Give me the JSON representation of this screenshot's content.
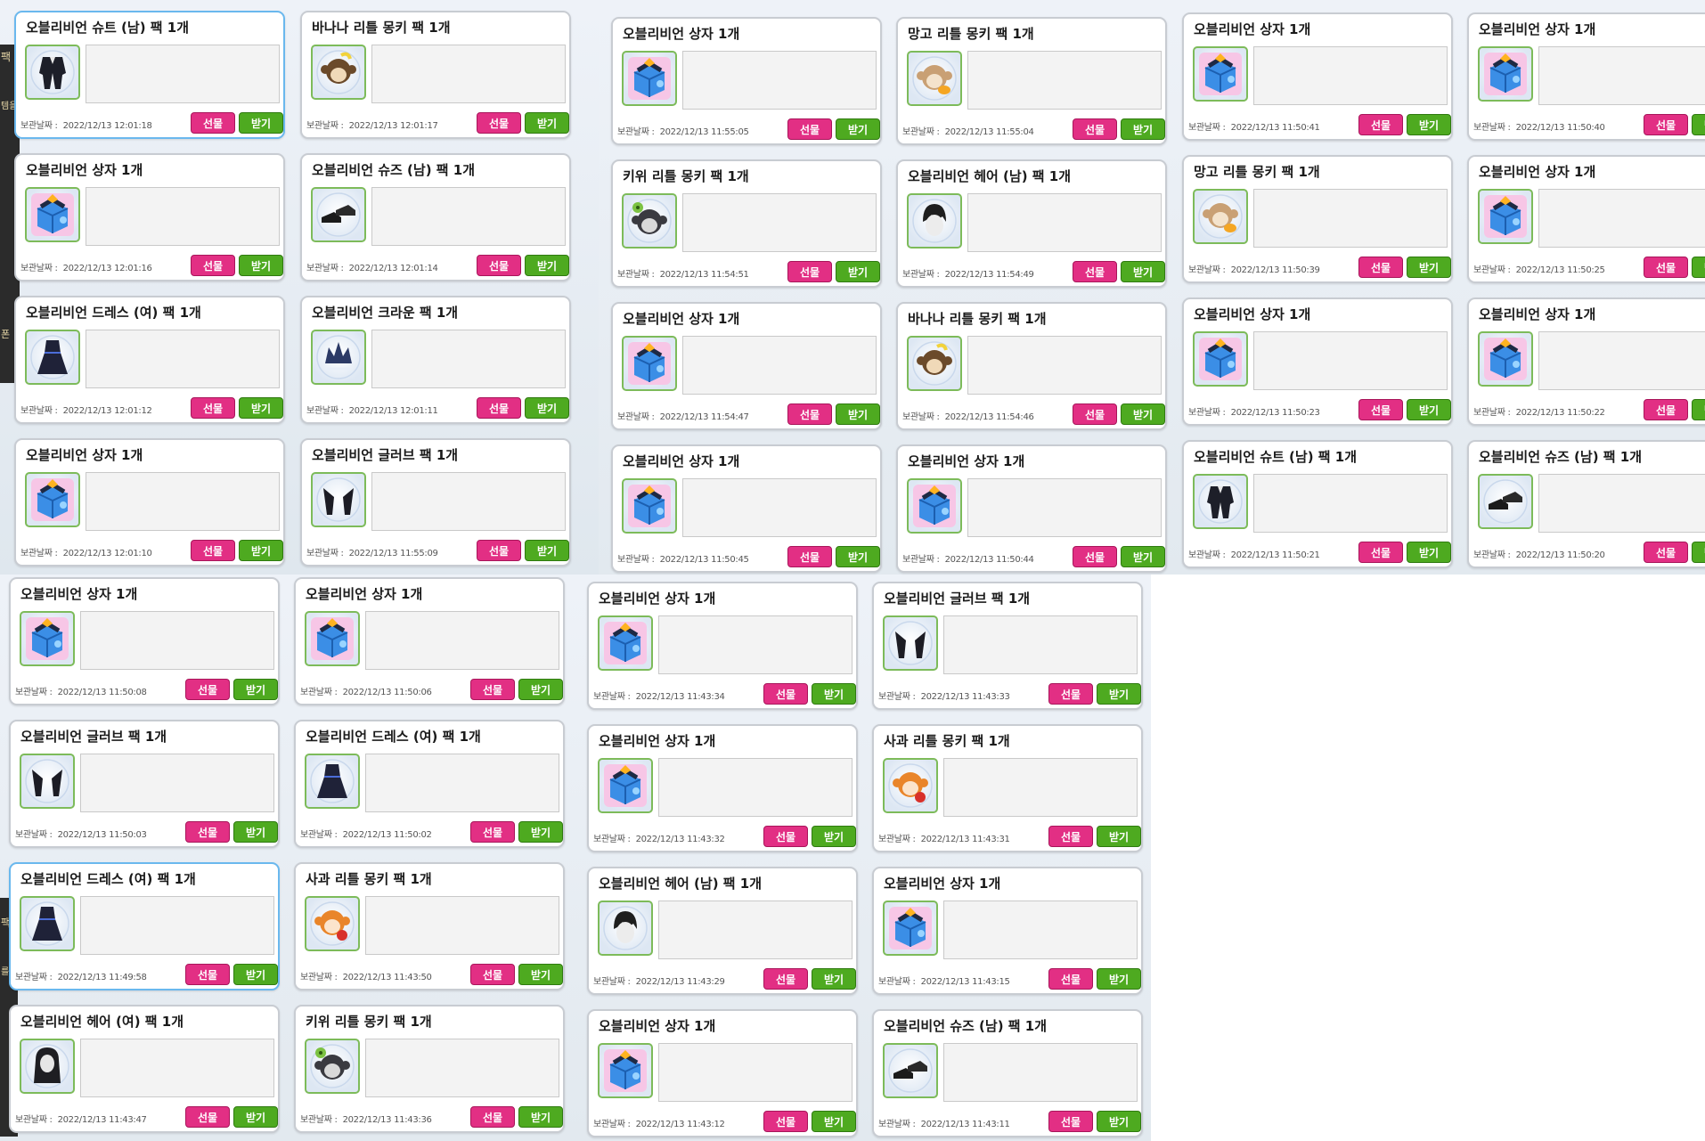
{
  "labels": {
    "date_label": "보관날짜 :",
    "gift_button": "선물",
    "receive_button": "받기"
  },
  "sidebar": {
    "left_top": [
      "팩",
      "템을",
      "폰"
    ],
    "left_bottom": [
      "팩",
      "를"
    ]
  },
  "colors": {
    "gift": "#e22f84",
    "receive": "#4eaa20",
    "selected_border": "#6ab8ee"
  },
  "cards": [
    {
      "title": "오블리비언 슈트 (남) 팩 1개",
      "icon": "suit-icon",
      "date": "2022/12/13 12:01:18",
      "selected": true
    },
    {
      "title": "바나나 리틀 몽키 팩 1개",
      "icon": "banana-monkey-icon",
      "date": "2022/12/13 12:01:17",
      "selected": false
    },
    {
      "title": "오블리비언 상자 1개",
      "icon": "gift-box-icon",
      "date": "2022/12/13 11:55:05",
      "selected": false
    },
    {
      "title": "망고 리틀 몽키 팩 1개",
      "icon": "mango-monkey-icon",
      "date": "2022/12/13 11:55:04",
      "selected": false
    },
    {
      "title": "오블리비언 상자 1개",
      "icon": "gift-box-icon",
      "date": "2022/12/13 11:50:41",
      "selected": false
    },
    {
      "title": "오블리비언 상자 1개",
      "icon": "gift-box-icon",
      "date": "2022/12/13 11:50:40",
      "selected": false
    },
    {
      "title": "오블리비언 상자 1개",
      "icon": "gift-box-icon",
      "date": "2022/12/13 12:01:16",
      "selected": false
    },
    {
      "title": "오블리비언 슈즈 (남) 팩 1개",
      "icon": "shoes-icon",
      "date": "2022/12/13 12:01:14",
      "selected": false
    },
    {
      "title": "키위 리틀 몽키 팩 1개",
      "icon": "kiwi-monkey-icon",
      "date": "2022/12/13 11:54:51",
      "selected": false
    },
    {
      "title": "오블리비언 헤어 (남) 팩 1개",
      "icon": "hair-male-icon",
      "date": "2022/12/13 11:54:49",
      "selected": false
    },
    {
      "title": "망고 리틀 몽키 팩 1개",
      "icon": "mango-monkey-icon",
      "date": "2022/12/13 11:50:39",
      "selected": false
    },
    {
      "title": "오블리비언 상자 1개",
      "icon": "gift-box-icon",
      "date": "2022/12/13 11:50:25",
      "selected": false
    },
    {
      "title": "오블리비언 드레스 (여) 팩 1개",
      "icon": "dress-icon",
      "date": "2022/12/13 12:01:12",
      "selected": false
    },
    {
      "title": "오블리비언 크라운 팩 1개",
      "icon": "crown-icon",
      "date": "2022/12/13 12:01:11",
      "selected": false
    },
    {
      "title": "오블리비언 상자 1개",
      "icon": "gift-box-icon",
      "date": "2022/12/13 11:54:47",
      "selected": false
    },
    {
      "title": "바나나 리틀 몽키 팩 1개",
      "icon": "banana-monkey-icon",
      "date": "2022/12/13 11:54:46",
      "selected": false
    },
    {
      "title": "오블리비언 상자 1개",
      "icon": "gift-box-icon",
      "date": "2022/12/13 11:50:23",
      "selected": false
    },
    {
      "title": "오블리비언 상자 1개",
      "icon": "gift-box-icon",
      "date": "2022/12/13 11:50:22",
      "selected": false
    },
    {
      "title": "오블리비언 상자 1개",
      "icon": "gift-box-icon",
      "date": "2022/12/13 12:01:10",
      "selected": false
    },
    {
      "title": "오블리비언 글러브 팩 1개",
      "icon": "glove-icon",
      "date": "2022/12/13 11:55:09",
      "selected": false
    },
    {
      "title": "오블리비언 상자 1개",
      "icon": "gift-box-icon",
      "date": "2022/12/13 11:50:45",
      "selected": false
    },
    {
      "title": "오블리비언 상자 1개",
      "icon": "gift-box-icon",
      "date": "2022/12/13 11:50:44",
      "selected": false
    },
    {
      "title": "오블리비언 슈트 (남) 팩 1개",
      "icon": "suit-icon",
      "date": "2022/12/13 11:50:21",
      "selected": false
    },
    {
      "title": "오블리비언 슈즈 (남) 팩 1개",
      "icon": "shoes-icon",
      "date": "2022/12/13 11:50:20",
      "selected": false
    },
    {
      "title": "오블리비언 상자 1개",
      "icon": "gift-box-icon",
      "date": "2022/12/13 11:50:08",
      "selected": false
    },
    {
      "title": "오블리비언 상자 1개",
      "icon": "gift-box-icon",
      "date": "2022/12/13 11:50:06",
      "selected": false
    },
    {
      "title": "오블리비언 상자 1개",
      "icon": "gift-box-icon",
      "date": "2022/12/13 11:43:34",
      "selected": false
    },
    {
      "title": "오블리비언 글러브 팩 1개",
      "icon": "glove-icon",
      "date": "2022/12/13 11:43:33",
      "selected": false
    },
    {
      "title": "오블리비언 글러브 팩 1개",
      "icon": "glove-icon",
      "date": "2022/12/13 11:50:03",
      "selected": false
    },
    {
      "title": "오블리비언 드레스 (여) 팩 1개",
      "icon": "dress-icon",
      "date": "2022/12/13 11:50:02",
      "selected": false
    },
    {
      "title": "오블리비언 상자 1개",
      "icon": "gift-box-icon",
      "date": "2022/12/13 11:43:32",
      "selected": false
    },
    {
      "title": "사과 리틀 몽키 팩 1개",
      "icon": "apple-monkey-icon",
      "date": "2022/12/13 11:43:31",
      "selected": false
    },
    {
      "title": "오블리비언 드레스 (여) 팩 1개",
      "icon": "dress-icon",
      "date": "2022/12/13 11:49:58",
      "selected": true
    },
    {
      "title": "사과 리틀 몽키 팩 1개",
      "icon": "apple-monkey-icon",
      "date": "2022/12/13 11:43:50",
      "selected": false
    },
    {
      "title": "오블리비언 헤어 (남) 팩 1개",
      "icon": "hair-male-icon",
      "date": "2022/12/13 11:43:29",
      "selected": false
    },
    {
      "title": "오블리비언 상자 1개",
      "icon": "gift-box-icon",
      "date": "2022/12/13 11:43:15",
      "selected": false
    },
    {
      "title": "오블리비언 헤어 (여) 팩 1개",
      "icon": "hair-female-icon",
      "date": "2022/12/13 11:43:47",
      "selected": false
    },
    {
      "title": "키위 리틀 몽키 팩 1개",
      "icon": "kiwi-monkey-icon",
      "date": "2022/12/13 11:43:36",
      "selected": false
    },
    {
      "title": "오블리비언 상자 1개",
      "icon": "gift-box-icon",
      "date": "2022/12/13 11:43:12",
      "selected": false
    },
    {
      "title": "오블리비언 슈즈 (남) 팩 1개",
      "icon": "shoes-icon",
      "date": "2022/12/13 11:43:11",
      "selected": false
    }
  ]
}
